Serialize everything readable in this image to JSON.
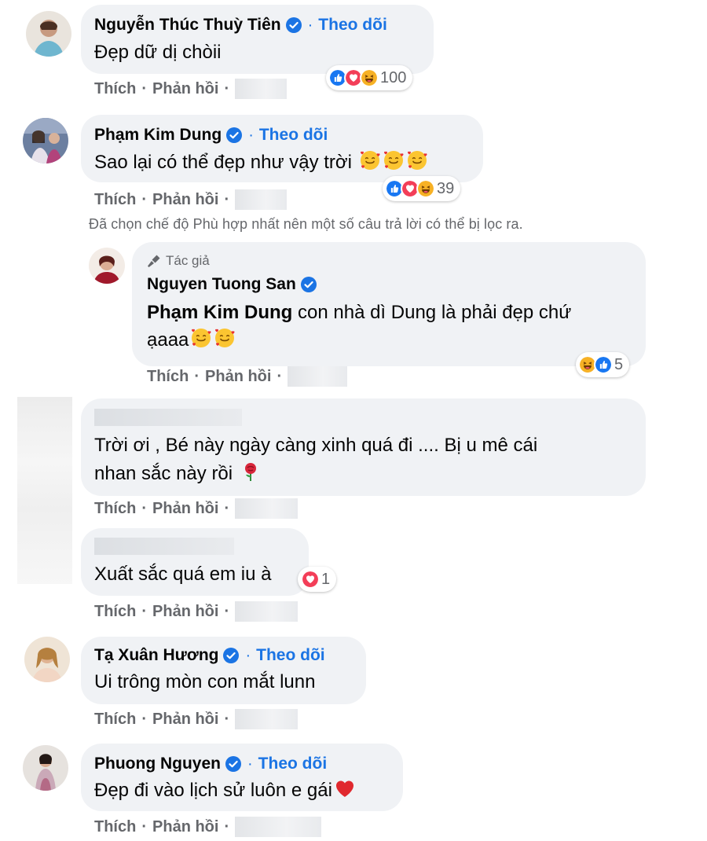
{
  "colors": {
    "accent": "#1b74e4",
    "bubble": "#f0f2f5",
    "muted": "#65676b",
    "like": "#1877f2",
    "love": "#f33e58",
    "haha": "#f7b125"
  },
  "actions": {
    "like": "Thích",
    "reply": "Phản hồi",
    "dot": "·"
  },
  "follow_label": "Theo dõi",
  "notice": "Đã chọn chế độ Phù hợp nhất nên một số câu trả lời có thể bị lọc ra.",
  "comments": [
    {
      "name": "Nguyễn Thúc Thuỳ Tiên",
      "text": "Đẹp dữ dị chòii",
      "reaction_count": "100",
      "reactions": [
        "like-icon",
        "love-icon",
        "haha-icon"
      ]
    },
    {
      "name": "Phạm Kim Dung",
      "text": "Sao lại có thể đẹp như vậy trời",
      "reaction_count": "39",
      "reactions": [
        "like-icon",
        "love-icon",
        "haha-icon"
      ]
    },
    {
      "author_tag": "Tác giả",
      "name": "Nguyen Tuong San",
      "mention": "Phạm Kim Dung",
      "text_line1": " con nhà dì Dung là phải đẹp chứ",
      "text_line2": "ạaaa",
      "reaction_count": "5",
      "reactions": [
        "haha-icon",
        "like-icon"
      ]
    },
    {
      "text_line1": "Trời ơi , Bé này ngày càng xinh quá đi .... Bị u mê cái",
      "text_line2": "nhan sắc này rồi"
    },
    {
      "text": "Xuất sắc quá em iu à",
      "reaction_count": "1",
      "reactions": [
        "love-icon"
      ]
    },
    {
      "name": "Tạ Xuân Hương",
      "text": "Ui trông mòn con mắt lunn"
    },
    {
      "name": "Phuong Nguyen",
      "text": "Đẹp đi vào lịch sử luôn e gái"
    }
  ]
}
